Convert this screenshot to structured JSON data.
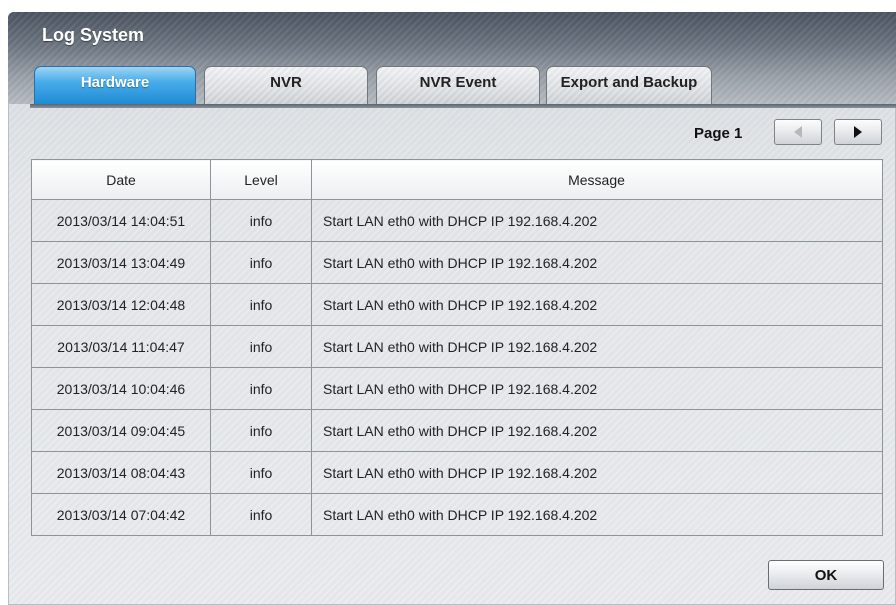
{
  "window": {
    "title": "Log System"
  },
  "tabs": [
    {
      "label": "Hardware",
      "active": true
    },
    {
      "label": "NVR",
      "active": false
    },
    {
      "label": "NVR Event",
      "active": false
    },
    {
      "label": "Export and Backup",
      "active": false
    }
  ],
  "pager": {
    "label": "Page 1",
    "prev_icon": "triangle-left-icon",
    "next_icon": "triangle-right-icon"
  },
  "table": {
    "columns": [
      "Date",
      "Level",
      "Message"
    ],
    "rows": [
      {
        "date": "2013/03/14  14:04:51",
        "level": "info",
        "message": "Start LAN eth0 with DHCP IP 192.168.4.202"
      },
      {
        "date": "2013/03/14  13:04:49",
        "level": "info",
        "message": "Start LAN eth0 with DHCP IP 192.168.4.202"
      },
      {
        "date": "2013/03/14  12:04:48",
        "level": "info",
        "message": "Start LAN eth0 with DHCP IP 192.168.4.202"
      },
      {
        "date": "2013/03/14  11:04:47",
        "level": "info",
        "message": "Start LAN eth0 with DHCP IP 192.168.4.202"
      },
      {
        "date": "2013/03/14  10:04:46",
        "level": "info",
        "message": "Start LAN eth0 with DHCP IP 192.168.4.202"
      },
      {
        "date": "2013/03/14  09:04:45",
        "level": "info",
        "message": "Start LAN eth0 with DHCP IP 192.168.4.202"
      },
      {
        "date": "2013/03/14  08:04:43",
        "level": "info",
        "message": "Start LAN eth0 with DHCP IP 192.168.4.202"
      },
      {
        "date": "2013/03/14  07:04:42",
        "level": "info",
        "message": "Start LAN eth0 with DHCP IP 192.168.4.202"
      }
    ]
  },
  "footer": {
    "ok_label": "OK"
  },
  "colors": {
    "active_tab": "#2a9ae0",
    "header_dark": "#4b5561",
    "panel": "#e6e9ec"
  }
}
